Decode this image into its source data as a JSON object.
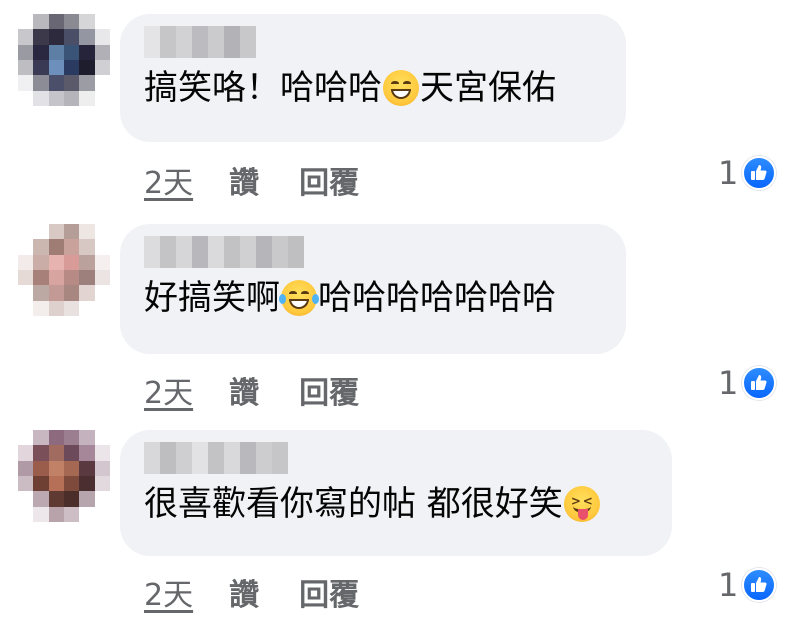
{
  "comments": [
    {
      "text_before": "搞笑咯！哈哈哈",
      "emoji": "grinning-face-emoji",
      "text_after": "天宮保佑",
      "time": "2天",
      "like_label": "讚",
      "reply_label": "回覆",
      "reaction_count": "1",
      "reaction_icon": "like-icon"
    },
    {
      "text_before": "好搞笑啊",
      "emoji": "tears-of-joy-emoji",
      "text_after": "哈哈哈哈哈哈哈",
      "time": "2天",
      "like_label": "讚",
      "reply_label": "回覆",
      "reaction_count": "1",
      "reaction_icon": "like-icon"
    },
    {
      "text_before": "很喜歡看你寫的帖 都很好笑",
      "emoji": "squinting-tongue-emoji",
      "text_after": "",
      "time": "2天",
      "like_label": "讚",
      "reply_label": "回覆",
      "reaction_count": "1",
      "reaction_icon": "like-icon"
    }
  ],
  "colors": {
    "bubble": "#f0f2f5",
    "meta_text": "#65676b",
    "like_blue": "#0866ff"
  }
}
